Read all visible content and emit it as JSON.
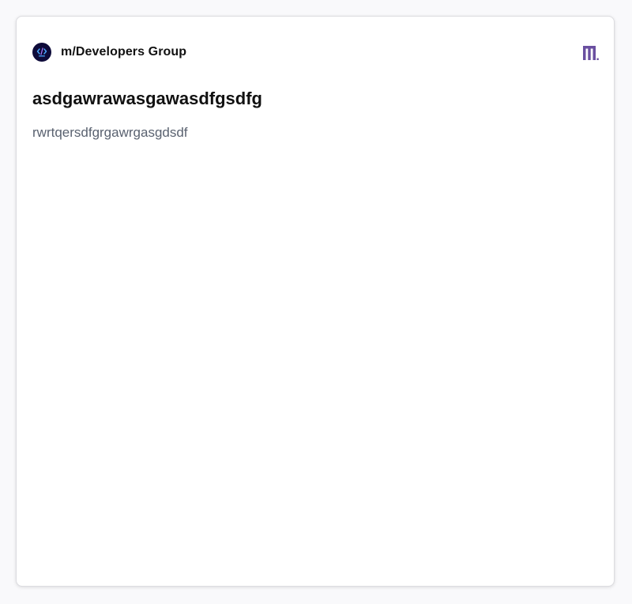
{
  "group": {
    "name": "m/Developers Group",
    "avatar_icon": "developers-group-logo-icon",
    "avatar_color": "#0e0b3a"
  },
  "brand": {
    "icon": "m-brand-logo-icon",
    "color": "#6a4fa0"
  },
  "post": {
    "title": "asdgawrawasgawasdfgsdfg",
    "body": "rwrtqersdfgrgawrgasgdsdf"
  }
}
